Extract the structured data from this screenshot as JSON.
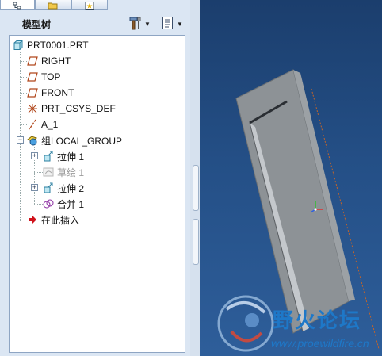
{
  "panel": {
    "title": "模型树"
  },
  "tabs": [
    {
      "name": "model-tree-tab",
      "icon": "tree-icon",
      "active": true
    },
    {
      "name": "folder-browser-tab",
      "icon": "folder-icon",
      "active": false
    },
    {
      "name": "favorites-tab",
      "icon": "star-icon",
      "active": false
    }
  ],
  "header_buttons": [
    {
      "icon": "tools-icon"
    },
    {
      "icon": "settings-list-icon"
    }
  ],
  "tree": {
    "items": [
      {
        "label": "PRT0001.PRT",
        "icon": "part-icon",
        "expander": "none"
      },
      {
        "label": "RIGHT",
        "icon": "datum-plane-icon",
        "expander": "none"
      },
      {
        "label": "TOP",
        "icon": "datum-plane-icon",
        "expander": "none"
      },
      {
        "label": "FRONT",
        "icon": "datum-plane-icon",
        "expander": "none"
      },
      {
        "label": "PRT_CSYS_DEF",
        "icon": "coordinate-system-icon",
        "expander": "none"
      },
      {
        "label": "A_1",
        "icon": "datum-axis-icon",
        "expander": "none"
      },
      {
        "label": "组LOCAL_GROUP",
        "icon": "group-icon",
        "expander": "minus"
      },
      {
        "label": "拉伸 1",
        "icon": "extrude-icon",
        "expander": "plus"
      },
      {
        "label": "草绘 1",
        "icon": "sketch-icon",
        "expander": "none",
        "dim": true
      },
      {
        "label": "拉伸 2",
        "icon": "extrude-icon",
        "expander": "plus"
      },
      {
        "label": "合并 1",
        "icon": "merge-icon",
        "expander": "none"
      },
      {
        "label": "在此插入",
        "icon": "insert-here-arrow-icon",
        "expander": "none"
      }
    ]
  },
  "watermark": {
    "text": "野火论坛",
    "url": "www.proewildfire.cn"
  },
  "colors": {
    "accent": "#1e78c8",
    "viewport_bg": "#244f86",
    "part_face": "#8d9296",
    "insert_arrow": "#d0121b"
  }
}
